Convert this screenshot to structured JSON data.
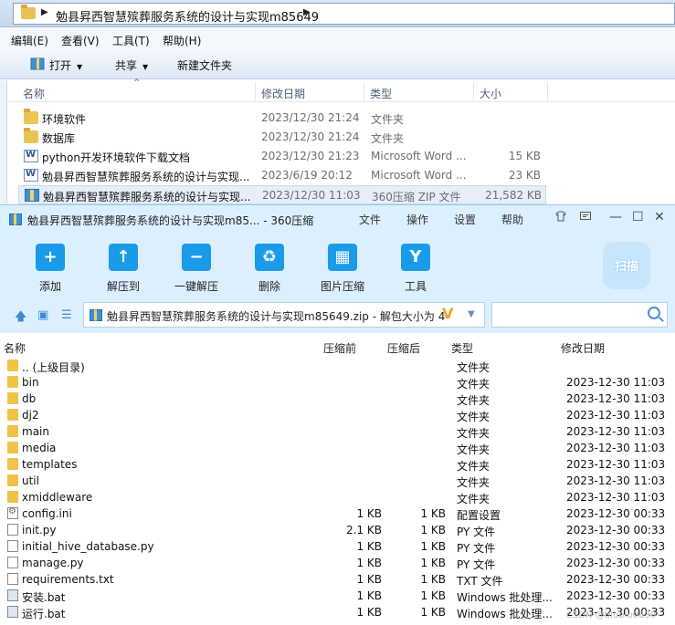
{
  "explorer": {
    "path": "勉县昇西智慧殡葬服务系统的设计与实现m85649",
    "menu": [
      "编辑(E)",
      "查看(V)",
      "工具(T)",
      "帮助(H)"
    ],
    "commands": {
      "open": "打开",
      "share": "共享",
      "new_folder": "新建文件夹"
    },
    "columns": {
      "name": "名称",
      "date": "修改日期",
      "type": "类型",
      "size": "大小"
    },
    "files": [
      {
        "icon": "folder-icon",
        "name": "环境软件",
        "date": "2023/12/30 21:24",
        "type": "文件夹",
        "size": ""
      },
      {
        "icon": "folder-icon",
        "name": "数据库",
        "date": "2023/12/30 21:24",
        "type": "文件夹",
        "size": ""
      },
      {
        "icon": "word-doc-icon",
        "name": "python开发环境软件下载文档",
        "date": "2023/12/30 21:23",
        "type": "Microsoft Word ...",
        "size": "15 KB"
      },
      {
        "icon": "word-doc-icon",
        "name": "勉县昇西智慧殡葬服务系统的设计与实现...",
        "date": "2023/6/19 20:12",
        "type": "Microsoft Word ...",
        "size": "23 KB"
      },
      {
        "icon": "zip-archive-icon",
        "name": "勉县昇西智慧殡葬服务系统的设计与实现...",
        "date": "2023/12/30 11:03",
        "type": "360压缩 ZIP 文件",
        "size": "21,582 KB"
      }
    ]
  },
  "zip": {
    "title": "勉县昇西智慧殡葬服务系统的设计与实现m85... - 360压缩",
    "menu": [
      "文件",
      "操作",
      "设置",
      "帮助"
    ],
    "toolbar": [
      {
        "icon": "add-icon",
        "glyph": "+",
        "label": "添加"
      },
      {
        "icon": "extract-to-icon",
        "glyph": "↑",
        "label": "解压到"
      },
      {
        "icon": "one-click-extract-icon",
        "glyph": "−",
        "label": "一键解压"
      },
      {
        "icon": "delete-icon",
        "glyph": "♻",
        "label": "删除"
      },
      {
        "icon": "image-compress-icon",
        "glyph": "▦",
        "label": "图片压缩"
      },
      {
        "icon": "tools-icon",
        "glyph": "Y",
        "label": "工具"
      }
    ],
    "scan_label": "扫描",
    "path_text": "勉县昇西智慧殡葬服务系统的设计与实现m85649.zip - 解包大小为 4",
    "columns": {
      "name": "名称",
      "compressed": "压缩前",
      "original": "压缩后",
      "type": "类型",
      "date": "修改日期"
    },
    "rows": [
      {
        "icon": "folder-icon",
        "name": ".. (上级目录)",
        "compressed": "",
        "original": "",
        "type": "文件夹",
        "date": ""
      },
      {
        "icon": "folder-icon",
        "name": "bin",
        "compressed": "",
        "original": "",
        "type": "文件夹",
        "date": "2023-12-30 11:03"
      },
      {
        "icon": "folder-icon",
        "name": "db",
        "compressed": "",
        "original": "",
        "type": "文件夹",
        "date": "2023-12-30 11:03"
      },
      {
        "icon": "folder-icon",
        "name": "dj2",
        "compressed": "",
        "original": "",
        "type": "文件夹",
        "date": "2023-12-30 11:03"
      },
      {
        "icon": "folder-icon",
        "name": "main",
        "compressed": "",
        "original": "",
        "type": "文件夹",
        "date": "2023-12-30 11:03"
      },
      {
        "icon": "folder-icon",
        "name": "media",
        "compressed": "",
        "original": "",
        "type": "文件夹",
        "date": "2023-12-30 11:03"
      },
      {
        "icon": "folder-icon",
        "name": "templates",
        "compressed": "",
        "original": "",
        "type": "文件夹",
        "date": "2023-12-30 11:03"
      },
      {
        "icon": "folder-icon",
        "name": "util",
        "compressed": "",
        "original": "",
        "type": "文件夹",
        "date": "2023-12-30 11:03"
      },
      {
        "icon": "folder-icon",
        "name": "xmiddleware",
        "compressed": "",
        "original": "",
        "type": "文件夹",
        "date": "2023-12-30 11:03"
      },
      {
        "icon": "config-file-icon",
        "name": "config.ini",
        "compressed": "1 KB",
        "original": "1 KB",
        "type": "配置设置",
        "date": "2023-12-30 00:33"
      },
      {
        "icon": "file-icon",
        "name": "init.py",
        "compressed": "2.1 KB",
        "original": "1 KB",
        "type": "PY 文件",
        "date": "2023-12-30 00:33"
      },
      {
        "icon": "file-icon",
        "name": "initial_hive_database.py",
        "compressed": "1 KB",
        "original": "1 KB",
        "type": "PY 文件",
        "date": "2023-12-30 00:33"
      },
      {
        "icon": "file-icon",
        "name": "manage.py",
        "compressed": "1 KB",
        "original": "1 KB",
        "type": "PY 文件",
        "date": "2023-12-30 00:33"
      },
      {
        "icon": "file-icon",
        "name": "requirements.txt",
        "compressed": "1 KB",
        "original": "1 KB",
        "type": "TXT 文件",
        "date": "2023-12-30 00:33"
      },
      {
        "icon": "bat-file-icon",
        "name": "安装.bat",
        "compressed": "1 KB",
        "original": "1 KB",
        "type": "Windows 批处理...",
        "date": "2023-12-30 00:33"
      },
      {
        "icon": "bat-file-icon",
        "name": "运行.bat",
        "compressed": "1 KB",
        "original": "1 KB",
        "type": "Windows 批处理...",
        "date": "2023-12-30 00:33"
      }
    ],
    "watermark": "CSDN @biubiu0630"
  }
}
